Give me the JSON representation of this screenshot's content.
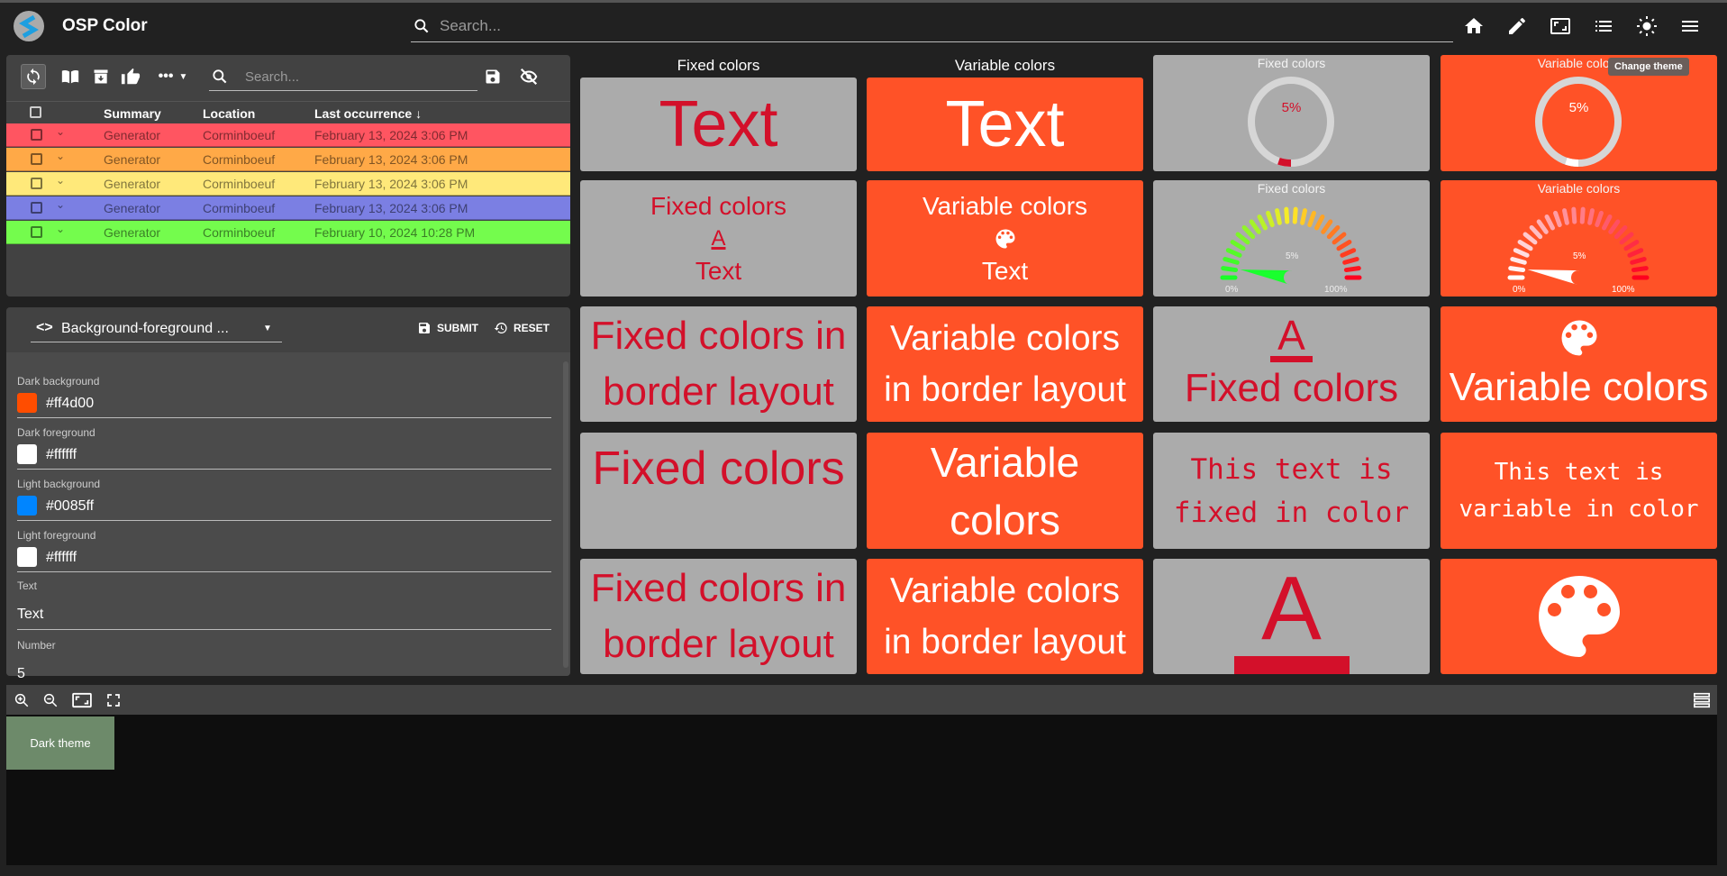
{
  "header": {
    "title": "OSP Color",
    "search_placeholder": "Search...",
    "icons": [
      "home-icon",
      "pencil-icon",
      "fit-screen-icon",
      "list-icon",
      "brightness-icon",
      "menu-icon"
    ],
    "tooltip": "Change theme"
  },
  "alarms": {
    "search_placeholder": "Search...",
    "columns": [
      "Summary",
      "Location",
      "Last occurrence"
    ],
    "rows": [
      {
        "summary": "Generator",
        "location": "Corminboeuf",
        "time": "February 13, 2024 3:06 PM",
        "color": "#ff5561"
      },
      {
        "summary": "Generator",
        "location": "Corminboeuf",
        "time": "February 13, 2024 3:06 PM",
        "color": "#ffa947"
      },
      {
        "summary": "Generator",
        "location": "Corminboeuf",
        "time": "February 13, 2024 3:06 PM",
        "color": "#ffe97a"
      },
      {
        "summary": "Generator",
        "location": "Corminboeuf",
        "time": "February 13, 2024 3:06 PM",
        "color": "#7b7fe3"
      },
      {
        "summary": "Generator",
        "location": "Corminboeuf",
        "time": "February 10, 2024 10:28 PM",
        "color": "#74fc4d"
      }
    ]
  },
  "form": {
    "select": "Background-foreground ...",
    "submit": "SUBMIT",
    "reset": "RESET",
    "fields": [
      {
        "label": "Dark background",
        "value": "#ff4d00",
        "swatch": "#ff4d00"
      },
      {
        "label": "Dark foreground",
        "value": "#ffffff",
        "swatch": "#ffffff"
      },
      {
        "label": "Light background",
        "value": "#0085ff",
        "swatch": "#0085ff"
      },
      {
        "label": "Light foreground",
        "value": "#ffffff",
        "swatch": "#ffffff"
      },
      {
        "label": "Text",
        "value": "Text"
      },
      {
        "label": "Number",
        "value": "5"
      }
    ]
  },
  "tiles": {
    "fixed": "Fixed colors",
    "variable": "Variable colors",
    "text": "Text",
    "fixed_border": "Fixed colors in border layout",
    "variable_border": "Variable colors in border layout",
    "fixed_mono": "This text is fixed in color",
    "variable_mono": "This text is variable in color",
    "gauge_value": "5%",
    "gauge_min": "0%",
    "gauge_max": "100%",
    "percent": 5
  },
  "colors": {
    "fixed_bg": "#ababab",
    "fixed_fg": "#d3102a",
    "variable_bg": "#ff5227",
    "variable_fg": "#ffffff"
  },
  "bottom": {
    "dark_theme": "Dark theme"
  }
}
